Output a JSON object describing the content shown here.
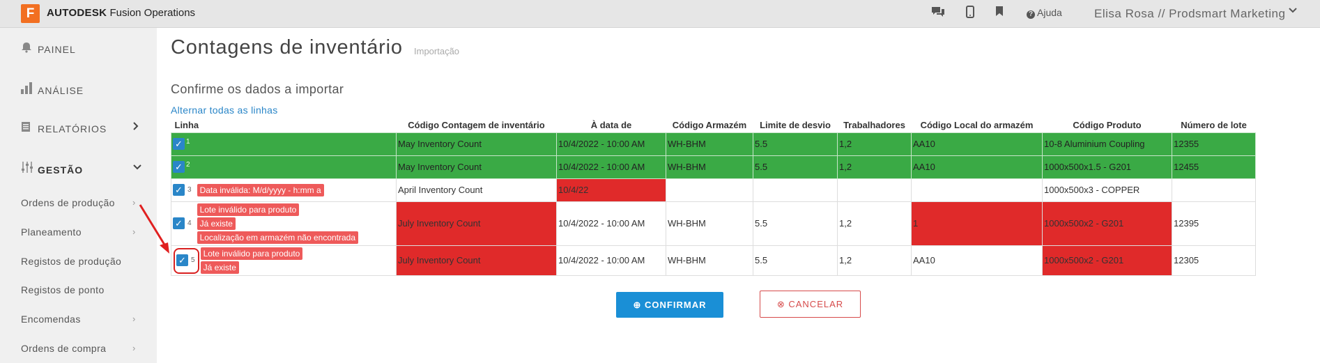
{
  "header": {
    "logo_letter": "F",
    "brand_bold": "AUTODESK",
    "brand_rest": "Fusion Operations",
    "help_label": "Ajuda",
    "user": "Elisa Rosa // Prodsmart Marketing"
  },
  "sidebar": {
    "main": [
      {
        "label": "PAINEL",
        "icon": "bell-icon"
      },
      {
        "label": "ANÁLISE",
        "icon": "bar-chart-icon"
      },
      {
        "label": "RELATÓRIOS",
        "icon": "report-icon"
      },
      {
        "label": "GESTÃO",
        "icon": "sliders-icon"
      }
    ],
    "sub": [
      "Ordens de produção",
      "Planeamento",
      "Registos de produção",
      "Registos de ponto",
      "Encomendas",
      "Ordens de compra"
    ]
  },
  "page": {
    "title": "Contagens de inventário",
    "subtitle": "Importação",
    "section_title": "Confirme os dados a importar",
    "toggle_all": "Alternar todas as linhas"
  },
  "table": {
    "headers": [
      "Linha",
      "Código Contagem de inventário",
      "À data de",
      "Código Armazém",
      "Limite de desvio",
      "Trabalhadores",
      "Código Local do armazém",
      "Código Produto",
      "Número de lote"
    ],
    "rows": [
      {
        "n": "1",
        "status": "ok",
        "errors": [],
        "cells": [
          "May Inventory Count",
          "10/4/2022 - 10:00 AM",
          "WH-BHM",
          "5.5",
          "1,2",
          "AA10",
          "10-8 Aluminium Coupling",
          "12355"
        ]
      },
      {
        "n": "2",
        "status": "ok",
        "errors": [],
        "cells": [
          "May Inventory Count",
          "10/4/2022 - 10:00 AM",
          "WH-BHM",
          "5.5",
          "1,2",
          "AA10",
          "1000x500x1.5 - G201",
          "12455"
        ]
      },
      {
        "n": "3",
        "status": "error",
        "errors": [
          "Data inválida: M/d/yyyy - h:mm a"
        ],
        "cells": [
          "April Inventory Count",
          "10/4/22",
          "",
          "",
          "",
          "",
          "1000x500x3 - COPPER",
          ""
        ]
      },
      {
        "n": "4",
        "status": "error",
        "errors": [
          "Lote inválido para produto",
          "Já existe",
          "Localização em armazém não encontrada"
        ],
        "cells": [
          "July Inventory Count",
          "10/4/2022 - 10:00 AM",
          "WH-BHM",
          "5.5",
          "1,2",
          "1",
          "1000x500x2 - G201",
          "12395"
        ]
      },
      {
        "n": "5",
        "status": "error",
        "errors": [
          "Lote inválido para produto",
          "Já existe"
        ],
        "cells": [
          "July Inventory Count",
          "10/4/2022 - 10:00 AM",
          "WH-BHM",
          "5.5",
          "1,2",
          "AA10",
          "1000x500x2 - G201",
          "12305"
        ]
      }
    ]
  },
  "buttons": {
    "confirm": "CONFIRMAR",
    "cancel": "CANCELAR"
  },
  "colors": {
    "ok_row": "#3aaa45",
    "error_cell": "#e02a2a",
    "badge": "#ee5a5a",
    "accent": "#1a8fd6"
  }
}
